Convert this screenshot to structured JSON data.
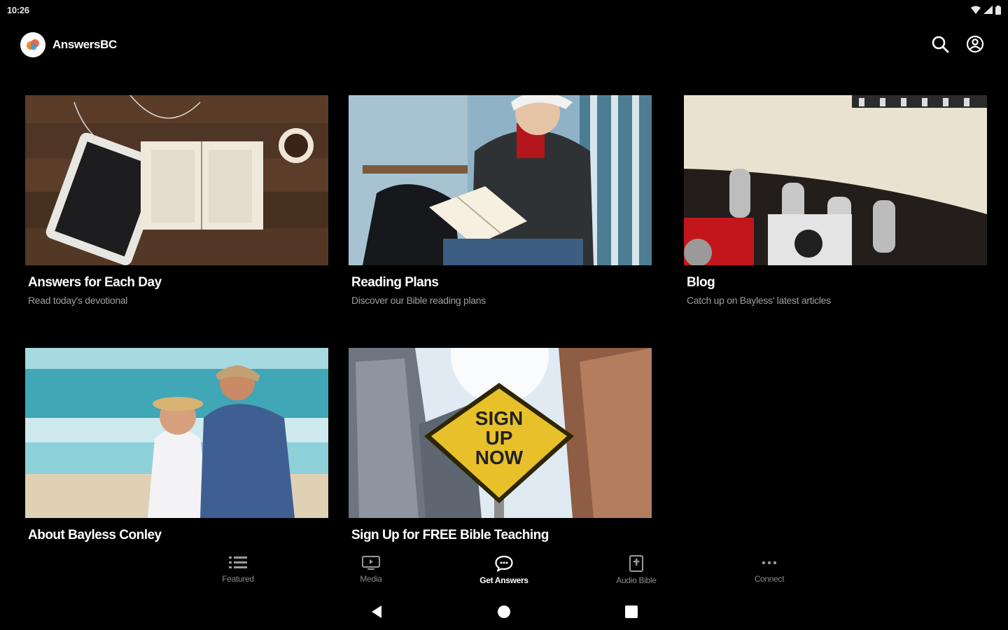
{
  "status_bar": {
    "time": "10:26",
    "icons": [
      "wifi-icon",
      "signal-icon",
      "battery-icon"
    ]
  },
  "app_bar": {
    "title": "AnswersBC",
    "actions": [
      "search-icon",
      "account-icon"
    ]
  },
  "cards": [
    {
      "title": "Answers for Each Day",
      "subtitle": "Read today's devotional",
      "image": "tablet-and-bible-on-wooden-table"
    },
    {
      "title": "Reading Plans",
      "subtitle": "Discover our Bible reading plans",
      "image": "young-man-reading-book"
    },
    {
      "title": "Blog",
      "subtitle": "Catch up on Bayless' latest articles",
      "image": "typewriter-blog-keys"
    },
    {
      "title": "About Bayless Conley",
      "subtitle": "",
      "image": "couple-on-beach"
    },
    {
      "title": "Sign Up for FREE Bible Teaching",
      "subtitle": "",
      "image": "sign-up-now-road-sign",
      "sign_text": [
        "SIGN",
        "UP",
        "NOW"
      ]
    }
  ],
  "bottom_nav": {
    "items": [
      {
        "label": "Featured",
        "icon": "list-icon",
        "active": false
      },
      {
        "label": "Media",
        "icon": "tv-icon",
        "active": false
      },
      {
        "label": "Get Answers",
        "icon": "chat-bubble-icon",
        "active": true
      },
      {
        "label": "Audio Bible",
        "icon": "bible-icon",
        "active": false
      },
      {
        "label": "Connect",
        "icon": "more-horizontal-icon",
        "active": false
      }
    ]
  },
  "system_nav": [
    "back-icon",
    "home-icon",
    "recents-icon"
  ],
  "colors": {
    "background": "#000000",
    "text": "#ffffff",
    "muted": "#9e9e9e",
    "sign_yellow": "#e8c12a"
  }
}
